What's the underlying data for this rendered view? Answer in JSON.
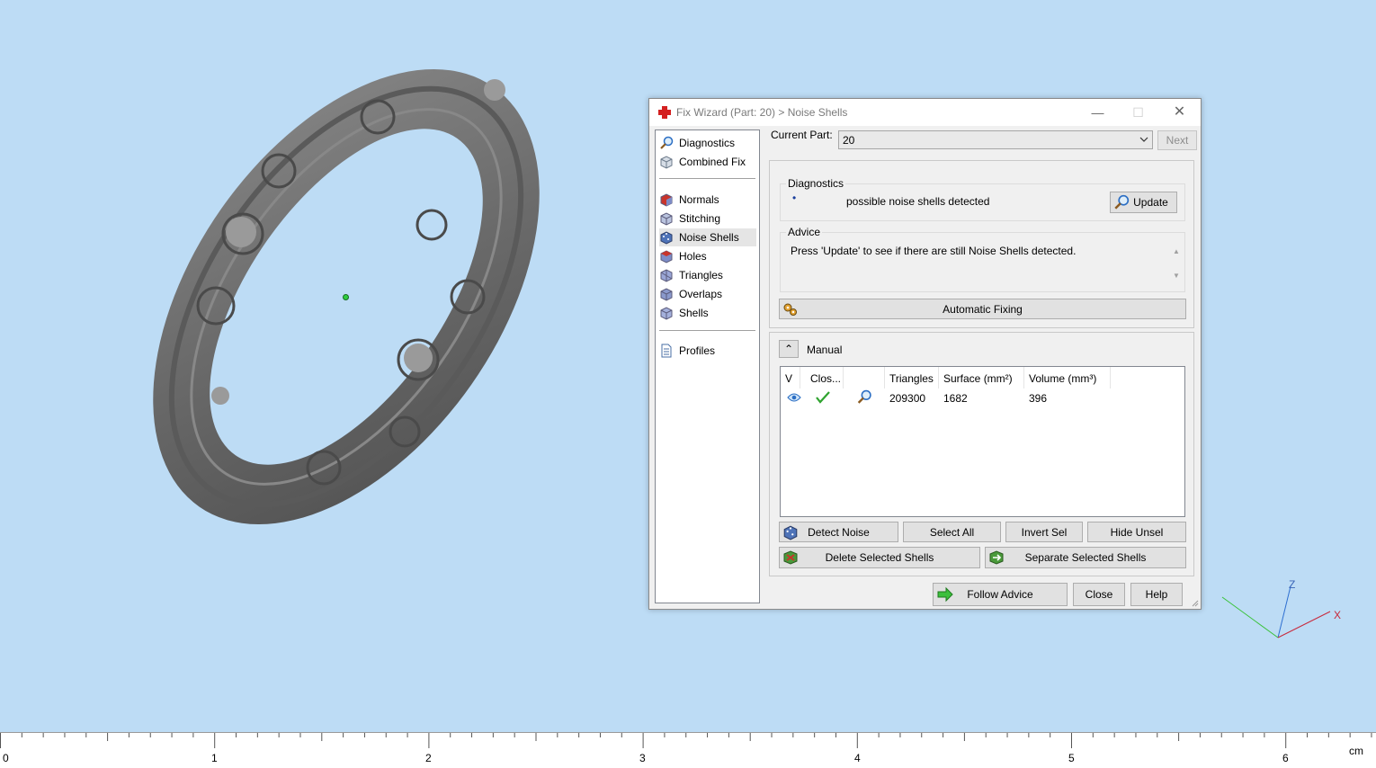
{
  "window": {
    "title": "Fix Wizard (Part: 20) > Noise Shells",
    "minimize": "—",
    "maximize": "☐",
    "close": "✕"
  },
  "nav": {
    "items": [
      {
        "label": "Diagnostics",
        "icon": "magnifier-icon"
      },
      {
        "label": "Combined Fix",
        "icon": "cube-icon"
      },
      {
        "label": "Normals",
        "icon": "normals-cube-icon"
      },
      {
        "label": "Stitching",
        "icon": "stitching-cube-icon"
      },
      {
        "label": "Noise Shells",
        "icon": "noise-cube-icon",
        "selected": true
      },
      {
        "label": "Holes",
        "icon": "holes-cube-icon"
      },
      {
        "label": "Triangles",
        "icon": "triangles-cube-icon"
      },
      {
        "label": "Overlaps",
        "icon": "overlaps-cube-icon"
      },
      {
        "label": "Shells",
        "icon": "shells-cube-icon"
      },
      {
        "label": "Profiles",
        "icon": "document-icon"
      }
    ]
  },
  "current_part": {
    "label": "Current Part:",
    "value": "20",
    "next_label": "Next"
  },
  "diagnostics": {
    "group_label": "Diagnostics",
    "bullet": "•",
    "message": "possible noise shells detected",
    "update_label": "Update"
  },
  "advice": {
    "group_label": "Advice",
    "text": "Press 'Update' to see if there are still Noise Shells detected.",
    "automatic_fixing_label": "Automatic Fixing"
  },
  "manual": {
    "toggle": "⌃",
    "label": "Manual",
    "columns": [
      "V",
      "Clos...",
      "",
      "Triangles",
      "Surface (mm²)",
      "Volume (mm³)"
    ],
    "rows": [
      {
        "triangles": "209300",
        "surface": "1682",
        "volume": "396"
      }
    ],
    "detect_noise_label": "Detect Noise",
    "select_all_label": "Select All",
    "invert_sel_label": "Invert Sel",
    "hide_unsel_label": "Hide Unsel",
    "delete_selected_label": "Delete Selected Shells",
    "separate_selected_label": "Separate Selected Shells"
  },
  "footer": {
    "follow_advice_label": "Follow Advice",
    "close_label": "Close",
    "help_label": "Help"
  },
  "axes": {
    "z": "Z",
    "x": "X"
  },
  "ruler": {
    "labels": [
      "0",
      "1",
      "2",
      "3",
      "4",
      "5",
      "6"
    ],
    "unit": "cm"
  },
  "colors": {
    "viewport_bg": "#bddcf5",
    "selected_nav": "#e5e5e5",
    "model_gray": "#6e6e6e"
  }
}
